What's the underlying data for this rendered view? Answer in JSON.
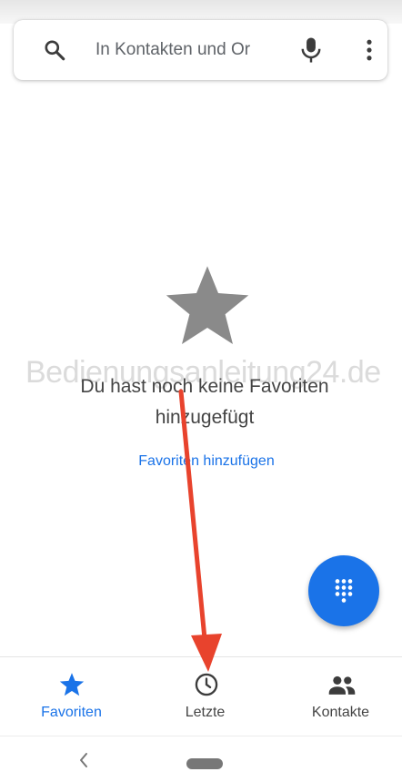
{
  "search": {
    "placeholder": "In Kontakten und Or",
    "value": ""
  },
  "icons": {
    "search": "search-icon",
    "mic": "microphone-icon",
    "more": "more-vert-icon",
    "star": "star-icon",
    "dialpad": "dialpad-icon",
    "recent": "clock-icon",
    "contacts": "people-icon",
    "back": "back-icon"
  },
  "empty_state": {
    "watermark": "Bedienungsanleitung24.de",
    "title": "Du hast noch keine Favoriten hinzugefügt",
    "action_label": "Favoriten hinzufügen"
  },
  "bottom_nav": {
    "active": "favorites",
    "items": [
      {
        "id": "favorites",
        "label": "Favoriten"
      },
      {
        "id": "recent",
        "label": "Letzte"
      },
      {
        "id": "contacts",
        "label": "Kontakte"
      }
    ]
  },
  "colors": {
    "accent": "#1a73e8",
    "annotation_arrow": "#e8432d",
    "empty_star": "#8a8a8a",
    "text": "#444444"
  }
}
